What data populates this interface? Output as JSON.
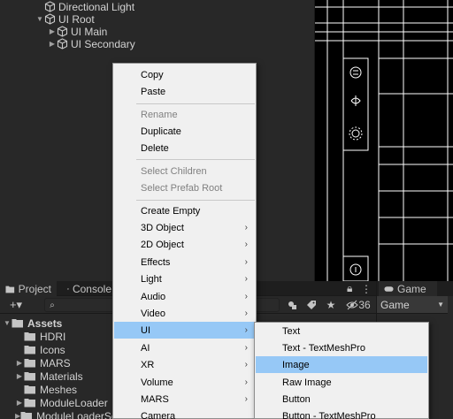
{
  "hierarchy": {
    "items": [
      {
        "label": "Directional Light",
        "expander": "",
        "icon": "gameobject-icon"
      },
      {
        "label": "UI Root",
        "expander": "▼",
        "icon": "gameobject-icon"
      },
      {
        "label": "UI Main",
        "expander": "▶",
        "icon": "gameobject-icon"
      },
      {
        "label": "UI Secondary",
        "expander": "▶",
        "icon": "gameobject-icon"
      }
    ]
  },
  "project": {
    "tabs": [
      {
        "label": "Project",
        "icon": "folder-icon"
      },
      {
        "label": "Console",
        "icon": "console-icon"
      }
    ],
    "toolbar": {
      "add_label": "+▾",
      "search_value": "",
      "hidden_count": "36"
    },
    "tree": {
      "root": "Assets",
      "folders": [
        "HDRI",
        "Icons",
        "MARS",
        "Materials",
        "Meshes",
        "ModuleLoader",
        "ModuleLoaderSettings"
      ]
    }
  },
  "game": {
    "tab_label": "Game",
    "select_value": "Game"
  },
  "context_menu": {
    "items": [
      "Copy",
      "Paste",
      "Rename",
      "Duplicate",
      "Delete",
      "Select Children",
      "Select Prefab Root",
      "Create Empty",
      "3D Object",
      "2D Object",
      "Effects",
      "Light",
      "Audio",
      "Video",
      "UI",
      "AI",
      "XR",
      "Volume",
      "MARS",
      "Camera"
    ],
    "selected": "UI"
  },
  "submenu": {
    "items": [
      "Text",
      "Text - TextMeshPro",
      "Image",
      "Raw Image",
      "Button",
      "Button - TextMeshPro"
    ],
    "selected": "Image"
  },
  "colors": {
    "menu_highlight": "#96c8f6",
    "menu_background": "#f0f0f0",
    "editor_background": "#282828"
  }
}
